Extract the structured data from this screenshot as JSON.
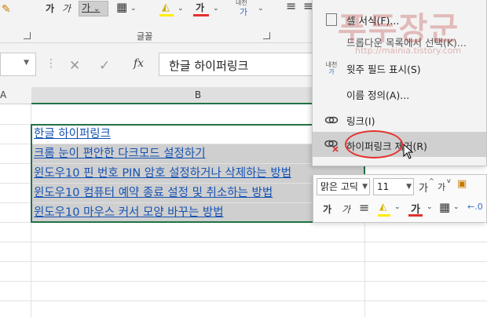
{
  "ribbon": {
    "font_group_label": "글꼴",
    "bold_label": "가",
    "italic_label": "가",
    "underline_label": "가",
    "underline_arrow": "⌄",
    "border_icon": "▦",
    "highlight_label": "가",
    "phonetic_label": "내천",
    "align_icon": "≡"
  },
  "formula_bar": {
    "namebox_arrow": "▼",
    "cancel_symbol": "✕",
    "enter_symbol": "✓",
    "fx_symbol": "fx",
    "content": "한글 하이퍼링크"
  },
  "grid": {
    "col_a": "A",
    "col_b": "B",
    "links": [
      "한글 하이퍼링크",
      "크롬 눈이 편안한 다크모드 설정하기",
      "윈도우10 핀 번호 PIN 암호 설정하거나 삭제하는 방법",
      "윈도우10 컴퓨터 예약 종료 설정 및 취소하는 방법",
      "윈도우10 마우스 커서 모양 바꾸는 방법"
    ]
  },
  "context_menu": {
    "items": [
      {
        "label": "셀 서식(F)...",
        "icon": "cell-format-icon"
      },
      {
        "label": "드롭다운 목록에서 선택(K)...",
        "icon": ""
      },
      {
        "label": "윗주 필드 표시(S)",
        "icon": "phonetic-icon"
      },
      {
        "label": "이름 정의(A)...",
        "icon": ""
      },
      {
        "label": "링크(I)",
        "icon": "link-icon"
      },
      {
        "label": "하이퍼링크 제거(R)",
        "icon": "remove-link-icon"
      }
    ],
    "phonetic_glyph": "내천"
  },
  "mini_toolbar": {
    "font_name": "맑은 고딕",
    "font_size": "11",
    "grow_label": "가",
    "shrink_label": "가",
    "bold_label": "가",
    "italic_label": "가",
    "align_icon": "≡",
    "font_color_label": "가"
  },
  "watermark": {
    "text": "푸두장군",
    "url": "http://mainia.tistory.com"
  },
  "colors": {
    "accent_green": "#217346",
    "link_blue": "#1552b3",
    "highlight_yellow": "#ffee00",
    "font_red": "#e3312d"
  }
}
